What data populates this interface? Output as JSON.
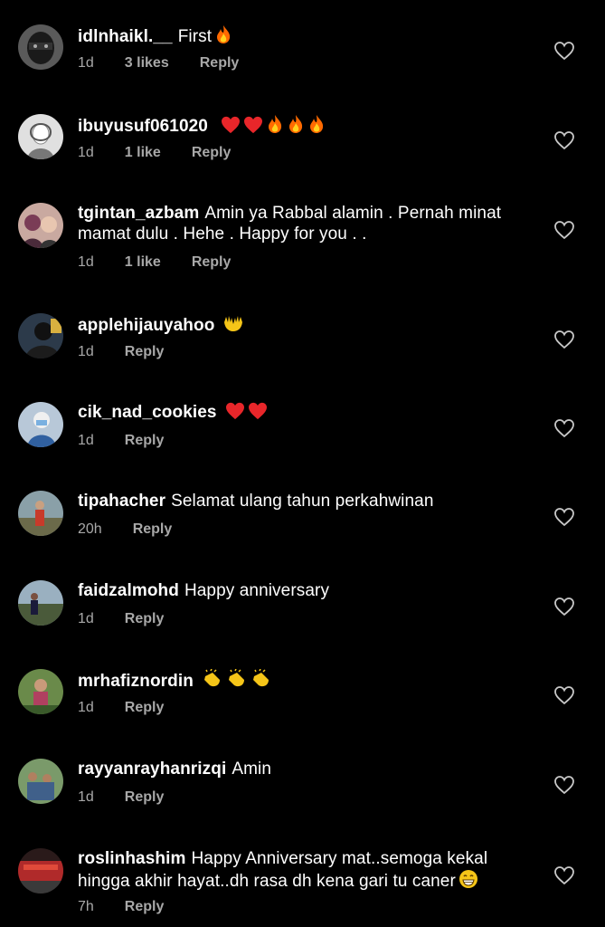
{
  "comments": [
    {
      "user": "idlnhaikl.__",
      "text": "First",
      "time": "1d",
      "likes": "3 likes",
      "reply": "Reply",
      "emoji": [
        "fire"
      ]
    },
    {
      "user": "ibuyusuf061020",
      "text": "",
      "time": "1d",
      "likes": "1 like",
      "reply": "Reply",
      "emoji": [
        "heart",
        "heart",
        "fire",
        "fire",
        "fire"
      ]
    },
    {
      "user": "tgintan_azbam",
      "text": "Amin ya Rabbal alamin . Pernah minat",
      "text2": "mamat dulu . Hehe . Happy for you . .",
      "time": "1d",
      "likes": "1 like",
      "reply": "Reply",
      "emoji": []
    },
    {
      "user": "applehijauyahoo",
      "text": "",
      "time": "1d",
      "likes": "",
      "reply": "Reply",
      "emoji": [
        "hands"
      ]
    },
    {
      "user": "cik_nad_cookies",
      "text": "",
      "time": "1d",
      "likes": "",
      "reply": "Reply",
      "emoji": [
        "heart",
        "heart"
      ]
    },
    {
      "user": "tipahacher",
      "text": "Selamat ulang tahun perkahwinan",
      "time": "20h",
      "likes": "",
      "reply": "Reply",
      "emoji": []
    },
    {
      "user": "faidzalmohd",
      "text": "Happy anniversary",
      "time": "1d",
      "likes": "",
      "reply": "Reply",
      "emoji": []
    },
    {
      "user": "mrhafiznordin",
      "text": "",
      "time": "1d",
      "likes": "",
      "reply": "Reply",
      "emoji": [
        "clap",
        "clap",
        "clap"
      ]
    },
    {
      "user": "rayyanrayhanrizqi",
      "text": "Amin",
      "time": "1d",
      "likes": "",
      "reply": "Reply",
      "emoji": []
    },
    {
      "user": "roslinhashim",
      "text": "Happy Anniversary mat..semoga kekal",
      "text2": "hingga akhir hayat..dh rasa dh kena gari tu caner",
      "time": "7h",
      "likes": "",
      "reply": "Reply",
      "emoji": [
        "grin"
      ]
    }
  ]
}
